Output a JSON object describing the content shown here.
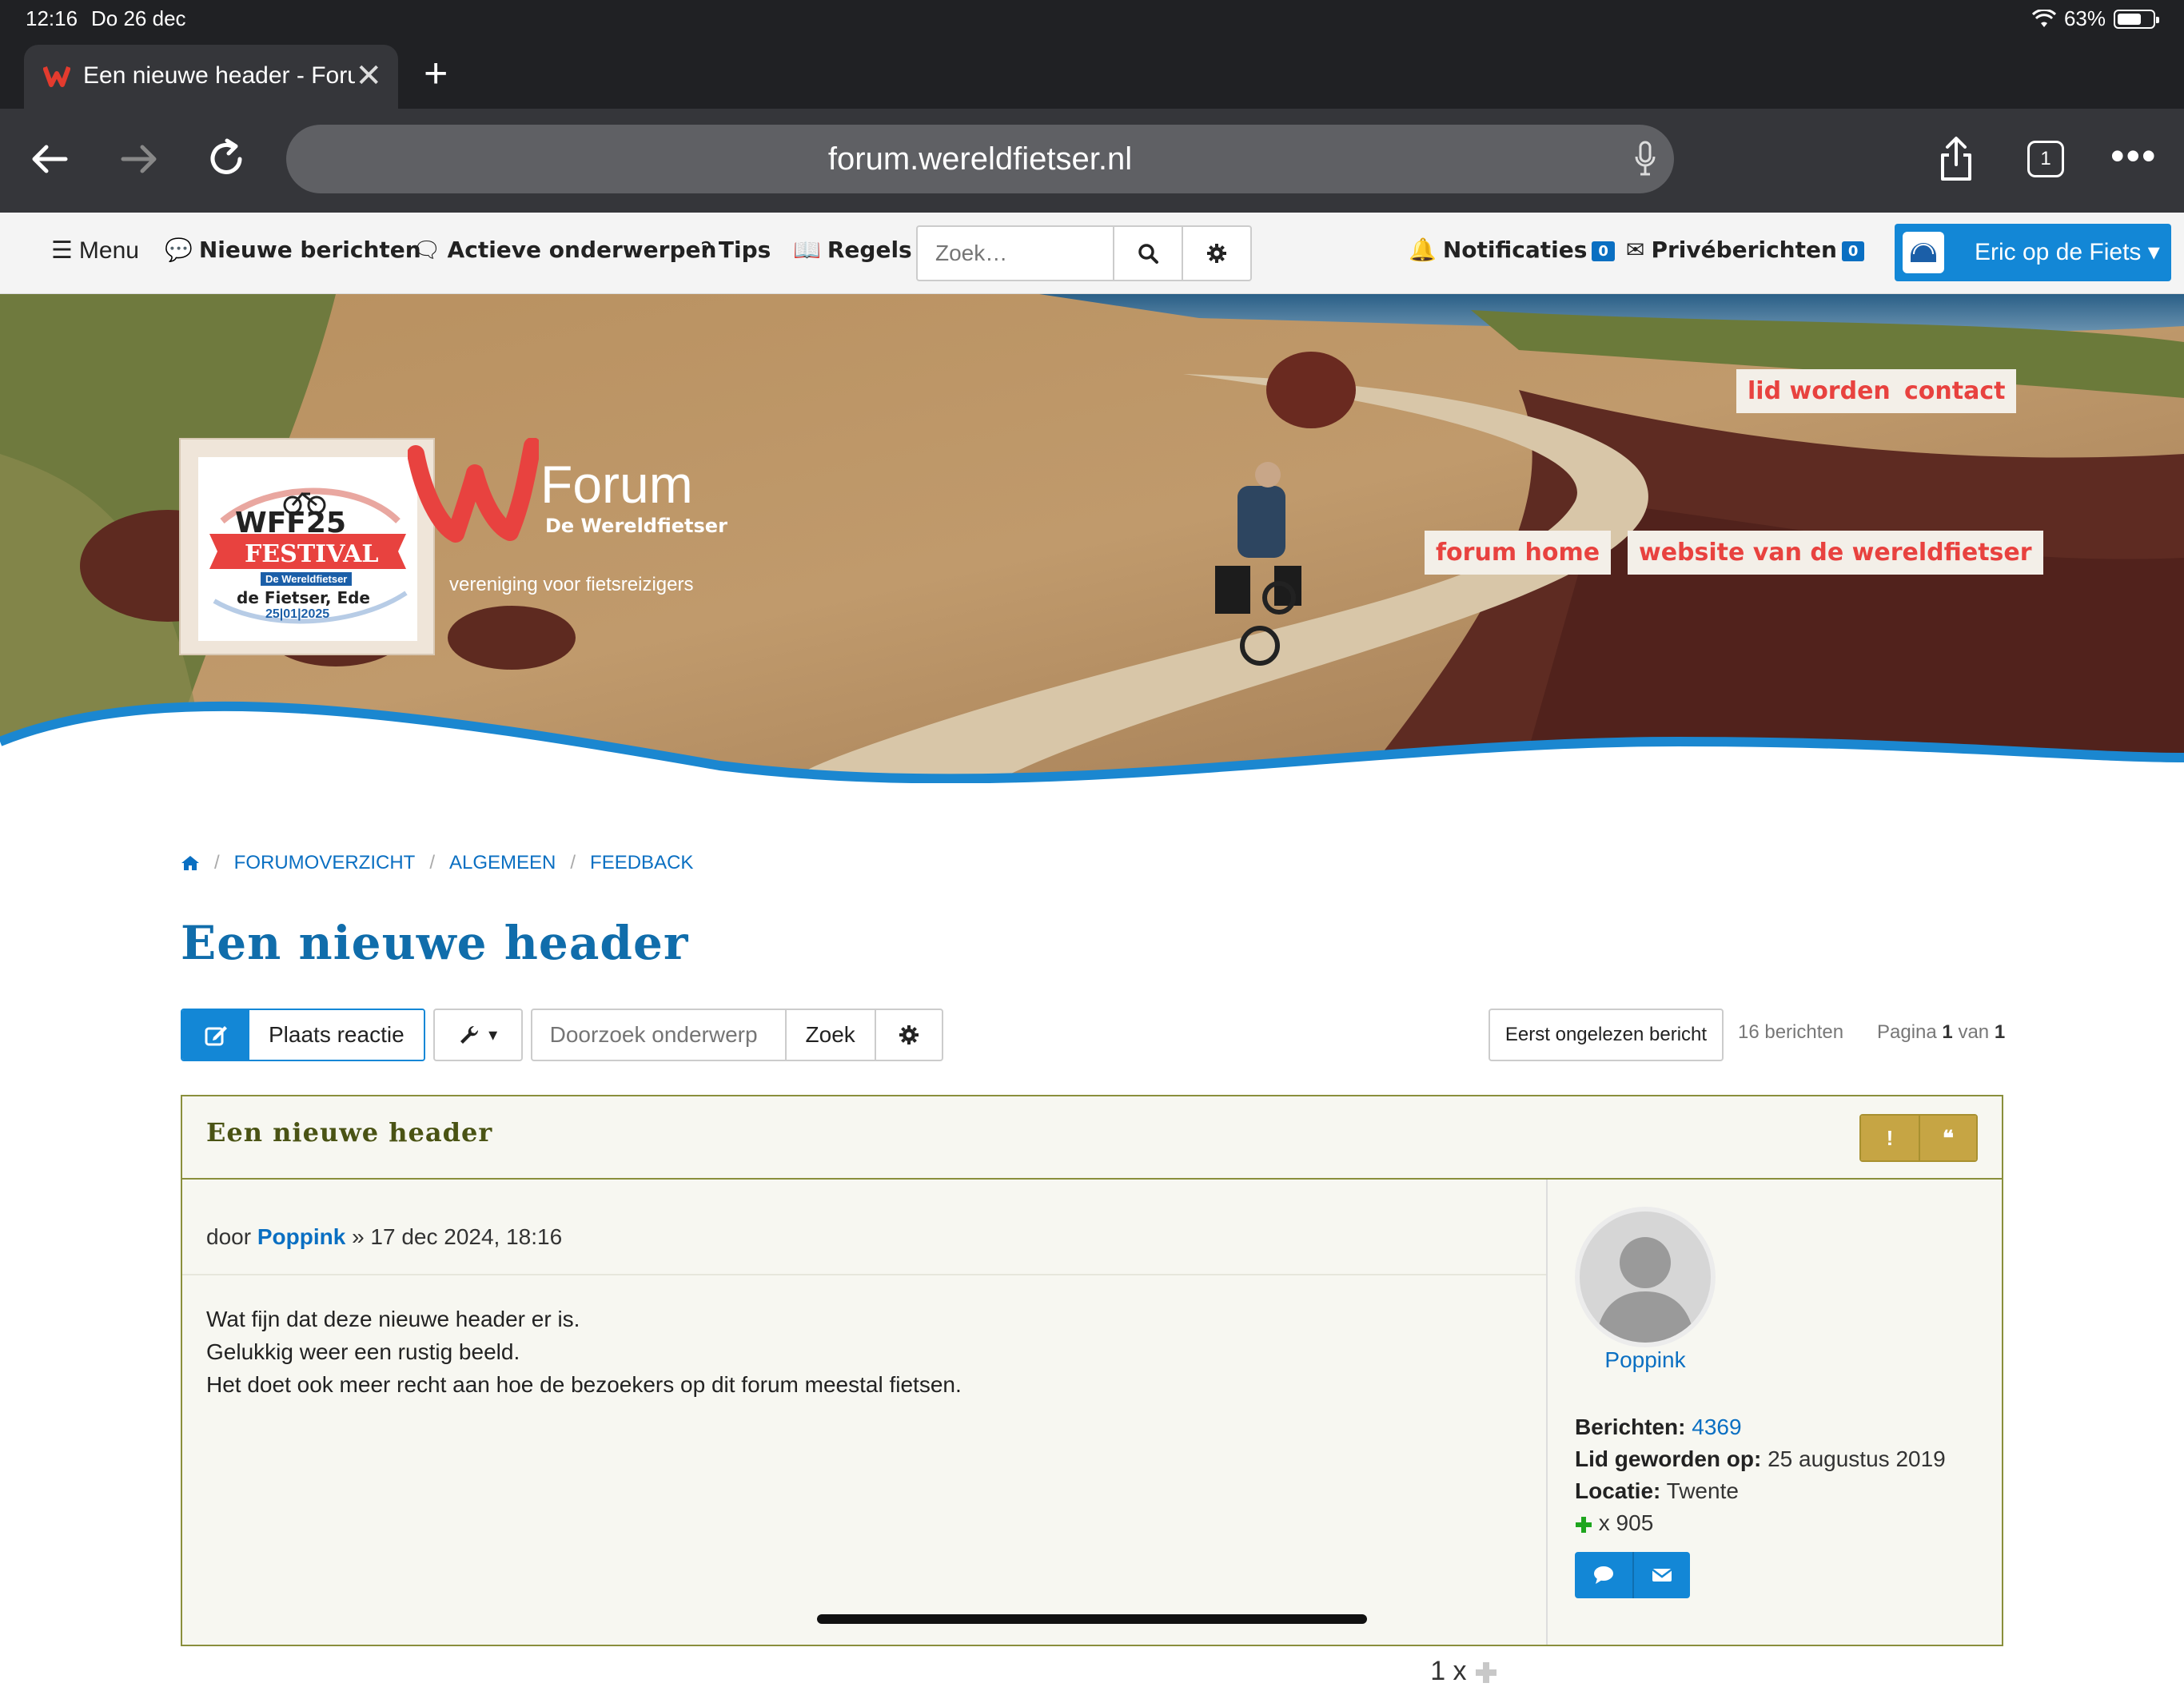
{
  "status": {
    "time": "12:16",
    "date": "Do 26 dec",
    "battery": "63%"
  },
  "browser": {
    "tab_title": "Een nieuwe header - Forum",
    "url": "forum.wereldfietser.nl",
    "tab_count": "1"
  },
  "forum_nav": {
    "menu": "Menu",
    "new_posts": "Nieuwe berichten",
    "active_topics": "Actieve onderwerpen",
    "tips": "Tips",
    "rules": "Regels",
    "search_placeholder": "Zoek…",
    "notifications": "Notificaties",
    "notifications_count": "0",
    "private_messages": "Privéberichten",
    "private_messages_count": "0",
    "user": "Eric op de Fiets"
  },
  "header": {
    "forum_title": "Forum",
    "forum_subtitle": "De Wereldfietser",
    "tagline": "vereniging voor fietsreizigers",
    "links": {
      "join": "lid worden",
      "contact": "contact",
      "forum_home": "forum home",
      "website": "website van de wereldfietser"
    },
    "logo": {
      "line1": "WFF25",
      "line2": "FESTIVAL",
      "line3": "De Wereldfietser",
      "line4": "de Fietser, Ede",
      "line5": "25|01|2025"
    }
  },
  "breadcrumbs": [
    "FORUMOVERZICHT",
    "ALGEMEEN",
    "FEEDBACK"
  ],
  "topic": {
    "title": "Een nieuwe header",
    "post_reply": "Plaats reactie",
    "search_placeholder": "Doorzoek onderwerp",
    "search_button": "Zoek",
    "unread_button": "Eerst ongelezen bericht",
    "post_count": "16 berichten",
    "page_label": "Pagina",
    "page_current": "1",
    "page_of": "van",
    "page_total": "1"
  },
  "post": {
    "title": "Een nieuwe header",
    "report_label": "!",
    "quote_label": "❝",
    "meta_prefix": "door",
    "author": "Poppink",
    "meta_suffix": "» 17 dec 2024, 18:16",
    "lines": [
      "Wat fijn dat deze nieuwe header er is.",
      "Gelukkig weer een rustig beeld.",
      "Het doet ook meer recht aan hoe de bezoekers op dit forum meestal fietsen."
    ],
    "likes": "1 x"
  },
  "profile": {
    "name": "Poppink",
    "posts_label": "Berichten:",
    "posts_value": "4369",
    "joined_label": "Lid geworden op:",
    "joined_value": "25 augustus 2019",
    "location_label": "Locatie:",
    "location_value": "Twente",
    "reputation": "x 905"
  },
  "colors": {
    "accent": "#1387d6",
    "title": "#106dab",
    "post_border": "#8a8f3c",
    "header_link": "#e8423f"
  }
}
